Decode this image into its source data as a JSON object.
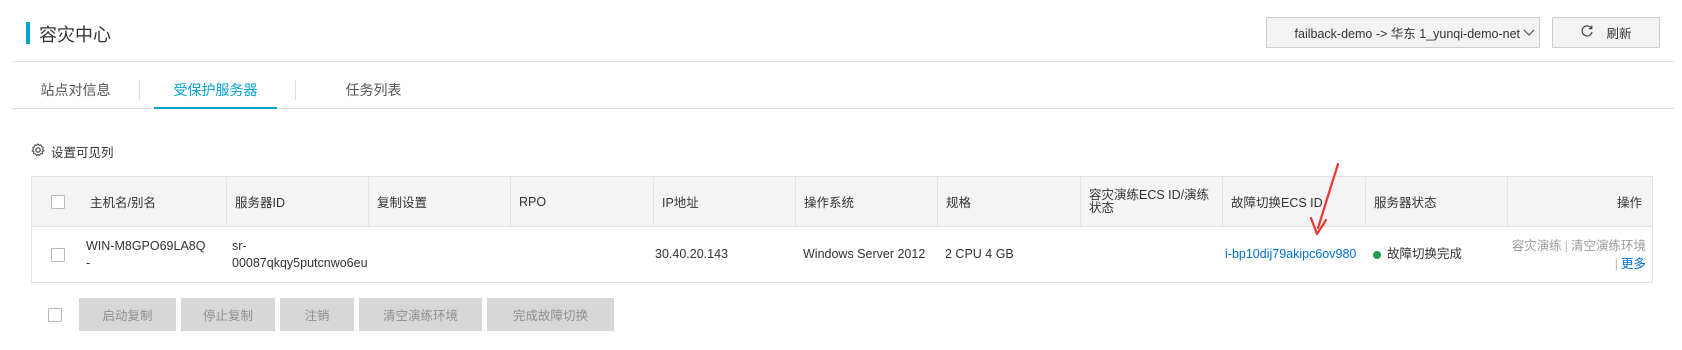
{
  "header": {
    "title": "容灾中心",
    "route_select_value": "failback-demo -> 华东 1_yunqi-demo-net",
    "refresh_label": "刷新"
  },
  "tabs": [
    {
      "label": "站点对信息",
      "active": false
    },
    {
      "label": "受保护服务器",
      "active": true
    },
    {
      "label": "任务列表",
      "active": false
    }
  ],
  "settings_label": "设置可见列",
  "table": {
    "columns": [
      "主机名/别名",
      "服务器ID",
      "复制设置",
      "RPO",
      "IP地址",
      "操作系统",
      "规格",
      "容灾演练ECS ID/演练状态",
      "故障切换ECS ID",
      "服务器状态",
      "操作"
    ],
    "rows": [
      {
        "hostname": "WIN-M8GPO69LA8Q",
        "alias": "-",
        "server_id_1": "sr-",
        "server_id_2": "00087qkqy5putcnwo6eu",
        "replication": "",
        "rpo": "",
        "ip": "30.40.20.143",
        "os": "Windows Server 2012",
        "spec": "2 CPU 4 GB",
        "drill_ecs": "",
        "failover_ecs": "i-bp10dij79akipc6ov980",
        "status": "故障切换完成",
        "status_color": "#1e9f4f",
        "actions": [
          "容灾演练",
          "清空演练环境",
          "更多"
        ]
      }
    ]
  },
  "bottom_buttons": [
    "启动复制",
    "停止复制",
    "注销",
    "清空演练环境",
    "完成故障切换"
  ],
  "colors": {
    "accent": "#00a2d0",
    "link": "#0070cc",
    "annotation": "#e8372e"
  }
}
